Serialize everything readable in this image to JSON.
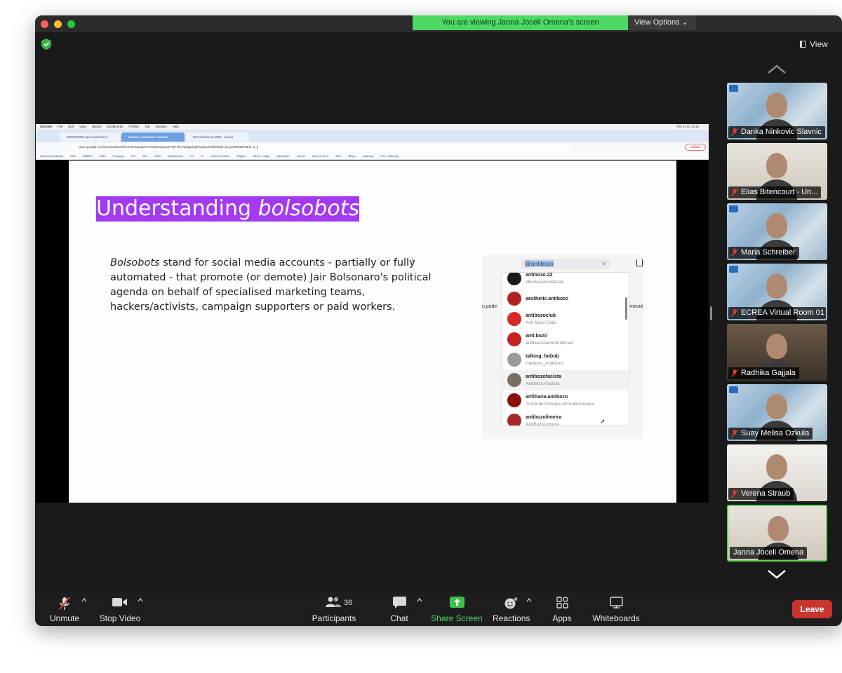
{
  "banner": {
    "viewing_text": "You are viewing Janna Joceli Omena's screen",
    "view_options_label": "View Options ⌄"
  },
  "header": {
    "view_label": "View"
  },
  "shared": {
    "menubar": [
      "Chrome",
      "File",
      "Edit",
      "View",
      "History",
      "Bookmarks",
      "Profiles",
      "Tab",
      "Window",
      "Help"
    ],
    "clock": "Thu 6 Oct 12:32",
    "tabs": [
      "2022 ECREA pre-conference",
      "abstract_bolsobots metodos",
      "Preconference 2022 - Visual"
    ],
    "url": "docs.google.com/presentation/d/14HXi0xqK8pXnxYNZ2edQoxsFrWFNl.oAa/Qgrl/qlrFCpDCcledit#slide=id.g1409848576e0_0_0",
    "update_label": "Update",
    "bookmarks": [
      "Research software",
      "DMI",
      "RMMLT",
      "Slots",
      "Teaching",
      "TeX",
      "DM",
      "CAIR",
      "WebArchive",
      "Cx",
      "Ja",
      "Labs & Centres",
      "Digitize",
      "Meme / Sage",
      "MyReader",
      "Grants",
      "News & Tech",
      "APIs",
      "Blogs",
      "Learning",
      "KCL / Sitemap"
    ]
  },
  "slide": {
    "title_plain": "Understanding ",
    "title_italic": "bolsobots",
    "body_italic": "Bolsobots",
    "body_rest": " stand for social media accounts - partially or fully automated - that promote (or demote) Jair Bolsonaro's political agenda on behalf of specialised marketing teams, hackers/activists, campaign supporters or paid workers."
  },
  "instagram": {
    "search_value": "@antibozo",
    "left_fragment": "u pode",
    "right_fragment": "movid",
    "results": [
      {
        "handle": "antibozo.22",
        "sub": "#BolsonaroVaiCair",
        "color": "#1a1a1a"
      },
      {
        "handle": "aesthetic.antibozo",
        "sub": "",
        "color": "#b32020"
      },
      {
        "handle": "antibozoclub",
        "sub": "Anti Bozo Club",
        "color": "#d62828"
      },
      {
        "handle": "anti.bozo",
        "sub": "antifascista#antimilicia#",
        "color": "#c42020"
      },
      {
        "handle": "talking_fatbob",
        "sub": "Harleyro_Antibozo",
        "color": "#9a9a9a"
      },
      {
        "handle": "antibozofacista",
        "sub": "Antibozo Facista",
        "color": "#7a6e64"
      },
      {
        "handle": "artilharia.antibozo",
        "sub": "Tropa de Choque #ForaBolsonaro",
        "color": "#8c1010"
      },
      {
        "handle": "antibozolimeira",
        "sub": "AntiBozoLimeira",
        "color": "#a52a2a"
      }
    ]
  },
  "participants": [
    {
      "name": "Danka Ninkovic Slavnic",
      "muted": true,
      "bg": "ecrea"
    },
    {
      "name": "Elias Bitencourt - Un...",
      "muted": true,
      "bg": "room"
    },
    {
      "name": "Maria Schreiber",
      "muted": true,
      "bg": "ecrea"
    },
    {
      "name": "ECREA Virtual Room 01",
      "muted": true,
      "bg": "ecrea"
    },
    {
      "name": "Radhika Gajjala",
      "muted": true,
      "bg": "books"
    },
    {
      "name": "Suay Melisa Ozkula",
      "muted": true,
      "bg": "ecrea"
    },
    {
      "name": "Verena Straub",
      "muted": true,
      "bg": "white"
    },
    {
      "name": "Janna Joceli Omena",
      "muted": false,
      "bg": "room"
    }
  ],
  "toolbar": {
    "unmute": "Unmute",
    "stop_video": "Stop Video",
    "participants": "Participants",
    "participant_count": "36",
    "chat": "Chat",
    "share_screen": "Share Screen",
    "reactions": "Reactions",
    "apps": "Apps",
    "whiteboards": "Whiteboards",
    "leave": "Leave"
  },
  "colors": {
    "banner_green": "#4cd964",
    "slide_title_bg": "#a33af0",
    "leave_red": "#c8352e",
    "active_speaker": "#63d35c"
  }
}
